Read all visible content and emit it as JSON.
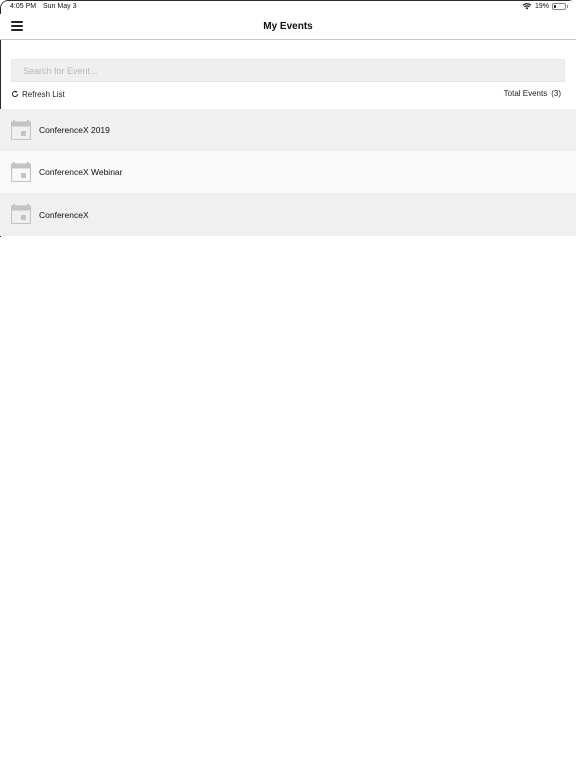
{
  "status_bar": {
    "time": "4:05 PM",
    "date": "Sun May 3",
    "battery_percent_label": "19%",
    "battery_level": 0.19,
    "wifi_icon": "wifi-icon",
    "battery_icon": "battery-icon"
  },
  "nav": {
    "title": "My Events",
    "menu_icon": "hamburger-menu-icon"
  },
  "search": {
    "placeholder": "Search for Event...",
    "value": ""
  },
  "toolbar": {
    "refresh_label": "Refresh List",
    "refresh_icon": "refresh-icon",
    "total_label": "Total Events",
    "total_count": "(3)"
  },
  "events": [
    {
      "name": "ConferenceX 2019",
      "icon": "calendar-icon"
    },
    {
      "name": "ConferenceX Webinar",
      "icon": "calendar-icon"
    },
    {
      "name": "ConferenceX",
      "icon": "calendar-icon"
    }
  ],
  "colors": {
    "row_alt_a": "#f0f0f0",
    "row_alt_b": "#fafafa",
    "icon_gray": "#c4c4c4",
    "divider": "#c8c8c8"
  }
}
